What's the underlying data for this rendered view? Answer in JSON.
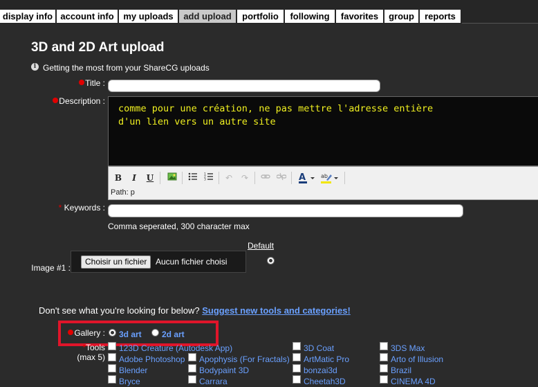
{
  "tabs": [
    {
      "label": "display info",
      "active": false
    },
    {
      "label": "account info",
      "active": false
    },
    {
      "label": "my uploads",
      "active": false
    },
    {
      "label": "add upload",
      "active": true
    },
    {
      "label": "portfolio",
      "active": false
    },
    {
      "label": "following",
      "active": false
    },
    {
      "label": "favorites",
      "active": false
    },
    {
      "label": "group",
      "active": false
    },
    {
      "label": "reports",
      "active": false
    }
  ],
  "page": {
    "title": "3D and 2D Art upload",
    "info_text": "Getting the most from your ShareCG uploads"
  },
  "form": {
    "title_label": "Title :",
    "title_value": "",
    "description_label": "Description :",
    "description_lines": [
      "comme pour une création, ne pas mettre l'adresse entière",
      "d'un lien vers un autre site"
    ],
    "editor_path": "Path: p",
    "keywords_label": "Keywords :",
    "keywords_value": "",
    "keywords_hint": "Comma seperated, 300 character max",
    "default_label": "Default",
    "image_label": "Image #1 :",
    "file_button": "Choisir un fichier",
    "file_status": "Aucun fichier choisi",
    "suggest_prefix": "Don't see what you're looking for below?",
    "suggest_link": "Suggest new tools and categories!",
    "gallery_label": "Gallery :",
    "gallery_options": [
      {
        "label": "3d art",
        "selected": true
      },
      {
        "label": "2d art",
        "selected": false
      }
    ],
    "tools_label": "Tools",
    "tools_max": "(max 5)",
    "tools": [
      [
        "123D Creature (Autodesk App)",
        "Adobe Photoshop",
        "Blender",
        "Bryce"
      ],
      [
        "",
        "Apophysis (For Fractals)",
        "Bodypaint 3D",
        "Carrara"
      ],
      [
        "3D Coat",
        "ArtMatic Pro",
        "bonzai3d",
        "Cheetah3D"
      ],
      [
        "3DS Max",
        "Arto of Illusion",
        "Brazil",
        "CINEMA 4D"
      ]
    ]
  },
  "colors": {
    "background": "#2b2b2b",
    "editor_text": "#f0f020",
    "link": "#6aa0ff",
    "required": "#e00000",
    "highlight_box": "#e0152a"
  }
}
